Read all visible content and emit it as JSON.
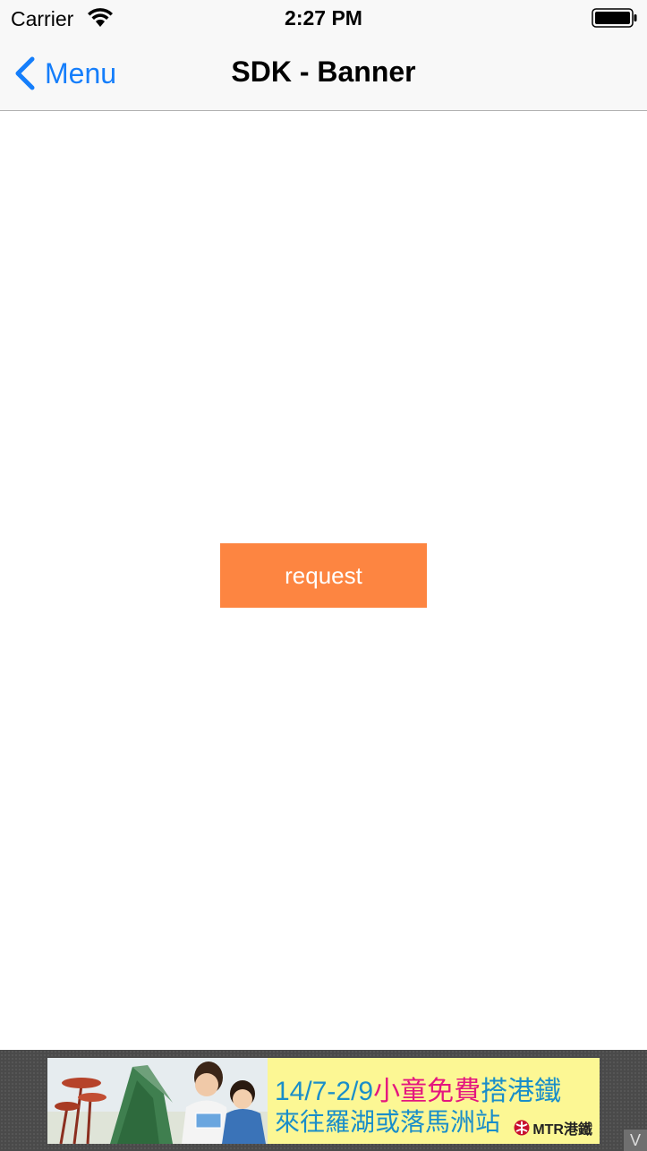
{
  "status_bar": {
    "carrier": "Carrier",
    "time": "2:27 PM",
    "wifi_icon": "wifi-icon",
    "battery_icon": "battery-icon"
  },
  "nav": {
    "back_label": "Menu",
    "back_icon": "chevron-left-icon",
    "title": "SDK - Banner"
  },
  "content": {
    "request_label": "request"
  },
  "banner": {
    "line1_dates": "14/7-2/9",
    "line1_highlight": "小童免費",
    "line1_rest": "搭港鐵",
    "line2": "來往羅湖或落馬洲站",
    "brand": "MTR港鐵",
    "corner_label": "V"
  },
  "colors": {
    "accent": "#157efb",
    "button": "#fd8541",
    "banner_bg": "#fcf794",
    "banner_text": "#1a8ec9",
    "banner_highlight": "#e4167f"
  }
}
